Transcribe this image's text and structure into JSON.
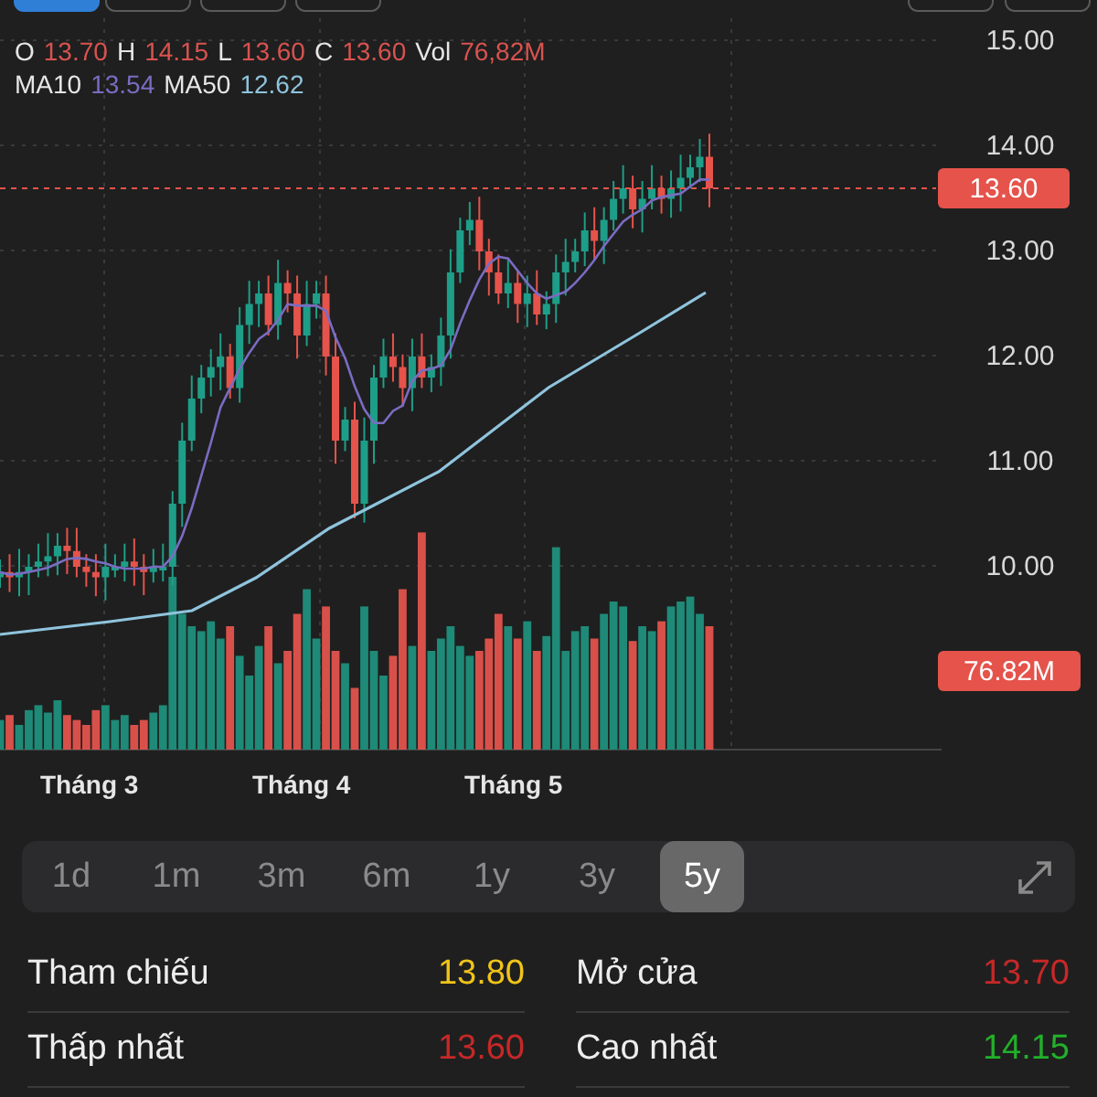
{
  "top_buttons": [
    {
      "selected": true
    },
    {
      "selected": false
    },
    {
      "selected": false
    },
    {
      "selected": false
    },
    {
      "selected": false
    },
    {
      "selected": false
    }
  ],
  "quote": [
    {
      "label": "O",
      "value": "13.70",
      "color": "#d9534f"
    },
    {
      "label": "H",
      "value": "14.15",
      "color": "#d9534f"
    },
    {
      "label": "L",
      "value": "13.60",
      "color": "#d9534f"
    },
    {
      "label": "C",
      "value": "13.60",
      "color": "#d9534f"
    },
    {
      "label": "Vol",
      "value": "76,82M",
      "color": "#d9534f"
    }
  ],
  "averages": [
    {
      "label": "MA10",
      "value": "13.54",
      "color": "#7a6cc2"
    },
    {
      "label": "MA50",
      "value": "12.62",
      "color": "#8fc4dd"
    }
  ],
  "chart": {
    "price_ticks": [
      "15.00",
      "14.00",
      "13.00",
      "12.00",
      "11.00",
      "10.00"
    ],
    "last_price": "13.60",
    "last_volume": "76.82M",
    "months": [
      "Tháng 3",
      "Tháng 4",
      "Tháng 5"
    ]
  },
  "ranges": [
    {
      "label": "1d",
      "selected": false
    },
    {
      "label": "1m",
      "selected": false
    },
    {
      "label": "3m",
      "selected": false
    },
    {
      "label": "6m",
      "selected": false
    },
    {
      "label": "1y",
      "selected": false
    },
    {
      "label": "3y",
      "selected": false
    },
    {
      "label": "5y",
      "selected": true
    }
  ],
  "stats": [
    {
      "label": "Tham chiếu",
      "value": "13.80",
      "color": "#f0c419"
    },
    {
      "label": "Mở cửa",
      "value": "13.70",
      "color": "#c62828"
    },
    {
      "label": "Thấp nhất",
      "value": "13.60",
      "color": "#c62828"
    },
    {
      "label": "Cao nhất",
      "value": "14.15",
      "color": "#22b02a"
    }
  ]
}
